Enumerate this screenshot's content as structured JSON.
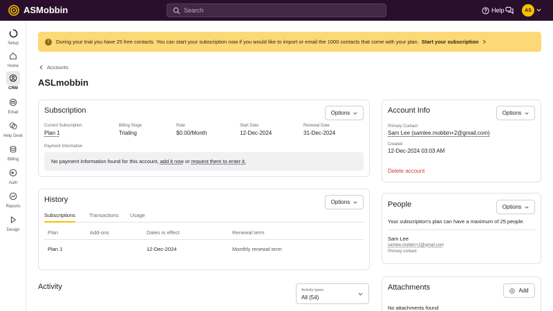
{
  "app": {
    "name": "ASMobbin",
    "brand_color": "#2a0f2c",
    "accent": "#f5c400"
  },
  "header": {
    "search_placeholder": "Search",
    "help_label": "Help",
    "avatar_initials": "AS"
  },
  "sidebar": {
    "items": [
      {
        "label": "Setup",
        "icon": "setup-icon"
      },
      {
        "label": "Home",
        "icon": "home-icon"
      },
      {
        "label": "CRM",
        "icon": "crm-icon",
        "active": true
      },
      {
        "label": "Email",
        "icon": "email-icon"
      },
      {
        "label": "Help Desk",
        "icon": "help-desk-icon"
      },
      {
        "label": "Billing",
        "icon": "billing-icon"
      },
      {
        "label": "Auth",
        "icon": "auth-icon"
      },
      {
        "label": "Reports",
        "icon": "reports-icon"
      },
      {
        "label": "Design",
        "icon": "design-icon"
      }
    ]
  },
  "banner": {
    "text": "During your trial you have 25 free contacts. You can start your subscription now if you would like to import or email the 1000 contacts that come with your plan.",
    "link": "Start your subscription"
  },
  "breadcrumb": "Accounts",
  "page_title": "ASLmobbin",
  "subscription": {
    "title": "Subscription",
    "options_label": "Options",
    "fields": [
      {
        "label": "Current Subscription",
        "value": "Plan 1"
      },
      {
        "label": "Billing Stage",
        "value": "Trialing"
      },
      {
        "label": "Rate",
        "value": "$0.00/Month"
      },
      {
        "label": "Start Date",
        "value": "12-Dec-2024"
      },
      {
        "label": "Renewal Date",
        "value": "31-Dec-2024"
      }
    ],
    "payment_label": "Payment Information",
    "payment_pre": "No payment information found for this account,",
    "payment_link1": "add it now",
    "payment_mid": "or",
    "payment_link2": "request them to enter it."
  },
  "history": {
    "title": "History",
    "options_label": "Options",
    "tabs": [
      "Subscriptions",
      "Transactions",
      "Usage"
    ],
    "columns": [
      "Plan",
      "Add-ons",
      "Dates in effect",
      "Renewal term"
    ],
    "rows": [
      {
        "plan": "Plan 1",
        "addons": "",
        "dates": "12-Dec-2024",
        "term": "Monthly renewal term"
      }
    ]
  },
  "activity": {
    "title": "Activity",
    "select_label": "Activity types",
    "select_value": "All (54)"
  },
  "account_info": {
    "title": "Account Info",
    "options_label": "Options",
    "primary_contact_label": "Primary Contact",
    "primary_contact_value": "Sam Lee (samlee.mobbin+2@gmail.com)",
    "created_label": "Created",
    "created_value": "12-Dec-2024 03:03 AM",
    "delete_label": "Delete account"
  },
  "people": {
    "title": "People",
    "options_label": "Options",
    "message": "Your subscription's plan can have a maximum of 25 people.",
    "person_name": "Sam Lee",
    "person_email": "samlee.mobbin+2@gmail.com",
    "person_role": "Primary contact"
  },
  "attachments": {
    "title": "Attachments",
    "add_label": "Add",
    "empty": "No attachments found"
  }
}
